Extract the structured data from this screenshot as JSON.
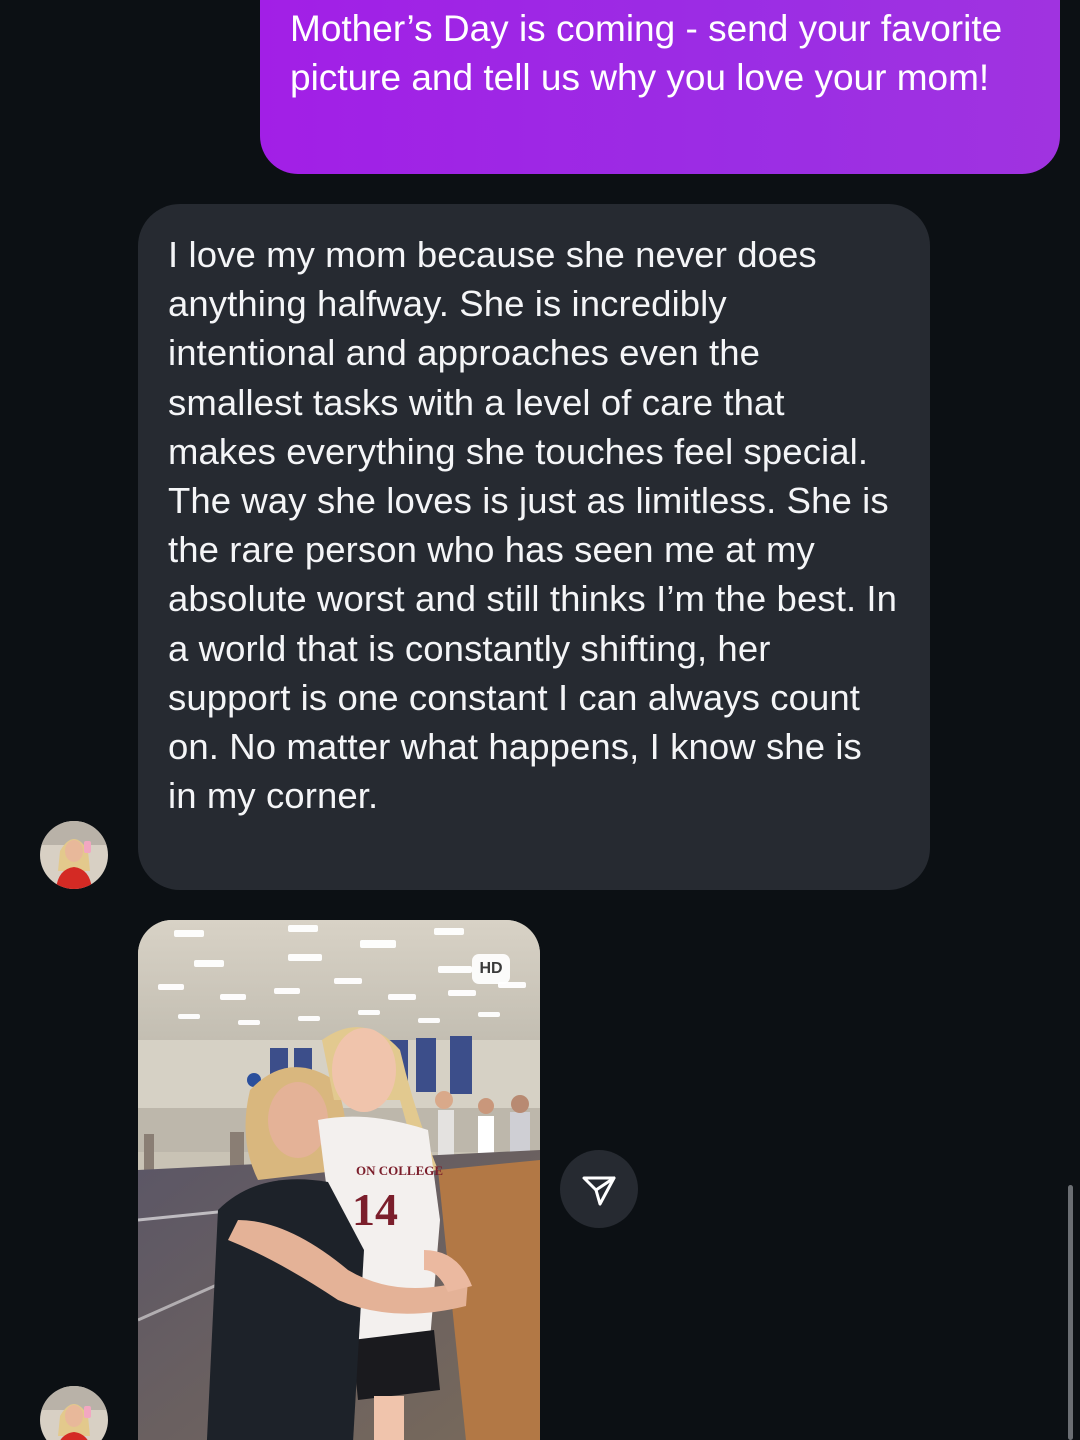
{
  "thread": {
    "sent_message": {
      "text": "Mother’s Day is coming - send your favorite picture and tell us why you love your mom!",
      "bubble_color": "#a21fe6"
    },
    "received_message": {
      "text": "I love my mom because she never does anything halfway. She is incredibly intentional and approaches even the smallest tasks with a level of care that makes everything she touches feel special. The way she loves is just as limitless. She is the rare person who has seen me at my absolute worst and still thinks I’m the best. In a world that is constantly shifting, her support is one constant I can always count on. No matter what happens, I know she is in my corner.",
      "bubble_color": "#262a31"
    },
    "photo_message": {
      "hd_badge": "HD",
      "jersey_text": "ON COLLEGE",
      "jersey_number": "14",
      "share_icon": "paper-plane-icon"
    }
  },
  "theme": {
    "background": "#0c1014",
    "text_primary": "#f4f5f7"
  }
}
